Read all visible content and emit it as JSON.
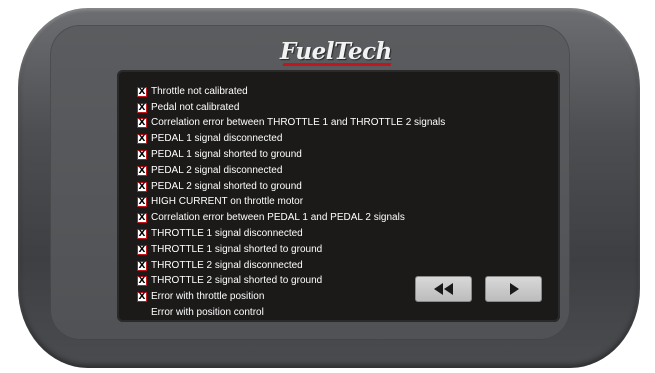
{
  "brand": {
    "logo_text": "FuelTech"
  },
  "errors": [
    {
      "label": "Throttle not calibrated",
      "flagged": true
    },
    {
      "label": "Pedal not calibrated",
      "flagged": true
    },
    {
      "label": "Correlation error between THROTTLE 1 and THROTTLE 2 signals",
      "flagged": true
    },
    {
      "label": "PEDAL 1 signal disconnected",
      "flagged": true
    },
    {
      "label": "PEDAL 1 signal shorted to ground",
      "flagged": true
    },
    {
      "label": "PEDAL 2 signal disconnected",
      "flagged": true
    },
    {
      "label": "PEDAL 2 signal shorted to ground",
      "flagged": true
    },
    {
      "label": "HIGH CURRENT on throttle motor",
      "flagged": true
    },
    {
      "label": "Correlation error between PEDAL 1 and PEDAL 2 signals",
      "flagged": true
    },
    {
      "label": "THROTTLE 1 signal disconnected",
      "flagged": true
    },
    {
      "label": "THROTTLE 1 signal shorted to ground",
      "flagged": true
    },
    {
      "label": "THROTTLE 2 signal disconnected",
      "flagged": true
    },
    {
      "label": "THROTTLE 2 signal shorted to ground",
      "flagged": true
    },
    {
      "label": "Error with throttle position",
      "flagged": true
    },
    {
      "label": "Error with position control",
      "flagged": false
    }
  ],
  "icons": {
    "error_flag": "x-box-icon",
    "prev": "rewind-icon",
    "next": "play-icon"
  },
  "colors": {
    "screen_bg": "#1b1a19",
    "text": "#ffffff",
    "flag_border": "#c0171f",
    "logo_accent": "#c0171f"
  }
}
